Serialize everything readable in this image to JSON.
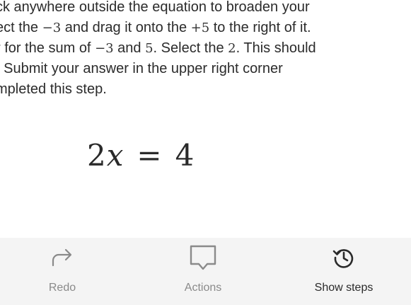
{
  "instructions": {
    "line1": "ck anywhere outside the equation to broaden your",
    "line2_a": "ect the ",
    "line2_m1": "−3",
    "line2_b": " and drag it onto the ",
    "line2_m2": "+5",
    "line2_c": " to the right of it.",
    "line3_a": "r for the sum of ",
    "line3_m1": "−3",
    "line3_b": " and ",
    "line3_m2": "5",
    "line3_c": ". Select the ",
    "line3_m3": "2",
    "line3_d": ". This should",
    "line4": ". Submit your answer in the upper right corner",
    "line5": "mpleted this step."
  },
  "equation": {
    "coef": "2",
    "var": "x",
    "eq": "=",
    "rhs": "4"
  },
  "bottom_bar": {
    "redo_label": "Redo",
    "actions_label": "Actions",
    "show_steps_label": "Show steps",
    "icons": {
      "redo": "redo-arrow-icon",
      "actions": "speech-bubble-icon",
      "show_steps": "history-icon"
    },
    "colors": {
      "disabled": "#8a8a8a",
      "enabled": "#2a2a2a"
    }
  }
}
